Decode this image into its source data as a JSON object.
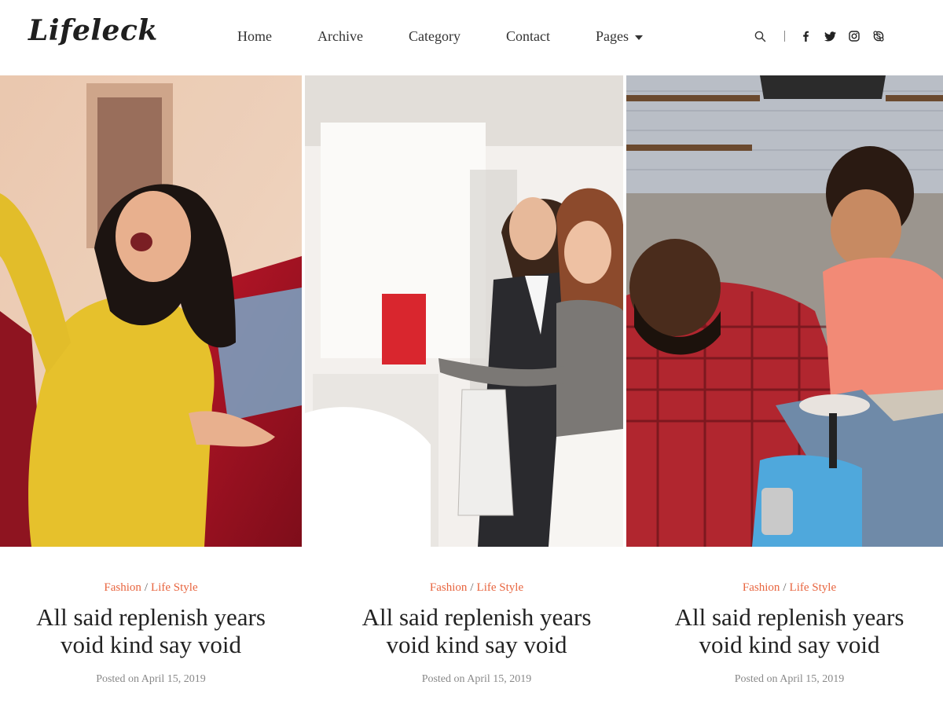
{
  "brand": {
    "logo": "Lifeleck"
  },
  "nav": {
    "items": [
      {
        "label": "Home"
      },
      {
        "label": "Archive"
      },
      {
        "label": "Category"
      },
      {
        "label": "Contact"
      },
      {
        "label": "Pages"
      }
    ]
  },
  "header_tools": {
    "icons": [
      "search-icon",
      "facebook-icon",
      "twitter-icon",
      "instagram-icon",
      "skype-icon"
    ]
  },
  "posts": [
    {
      "category_1": "Fashion",
      "separator": "/",
      "category_2": "Life Style",
      "title_line_1": "All said replenish years",
      "title_line_2": "void kind say void",
      "date": "Posted on April 15, 2019",
      "image": "woman-yellow-sweater-by-car"
    },
    {
      "category_1": "Fashion",
      "separator": "/",
      "category_2": "Life Style",
      "title_line_1": "All said replenish years",
      "title_line_2": "void kind say void",
      "date": "Posted on April 15, 2019",
      "image": "couple-at-car-showroom"
    },
    {
      "category_1": "Fashion",
      "separator": "/",
      "category_2": "Life Style",
      "title_line_1": "All said replenish years",
      "title_line_2": "void kind say void",
      "date": "Posted on April 15, 2019",
      "image": "father-and-son-with-toy-car"
    }
  ],
  "colors": {
    "accent": "#e8653f",
    "text": "#222222",
    "muted": "#888888"
  }
}
